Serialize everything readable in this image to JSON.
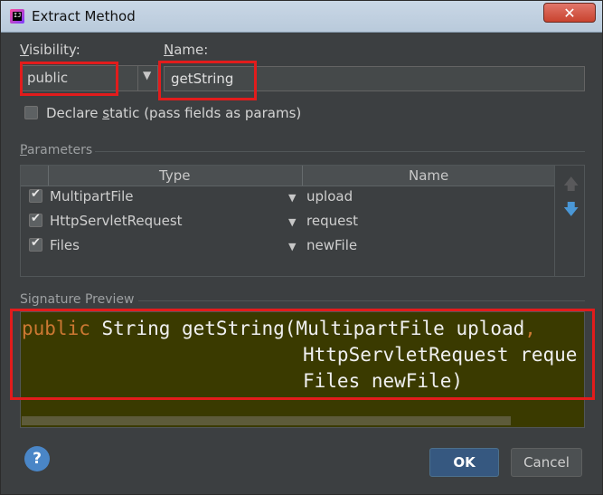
{
  "window": {
    "title": "Extract Method",
    "close_label": "✕"
  },
  "visibility": {
    "label_mnemonic": "V",
    "label_rest": "isibility:",
    "value": "public"
  },
  "name": {
    "label_mnemonic": "N",
    "label_rest": "ame:",
    "value": "getString"
  },
  "declare_static": {
    "checked": false,
    "label_pre": "Declare ",
    "label_mnemonic": "s",
    "label_post": "tatic (pass fields as params)"
  },
  "parameters": {
    "title_mnemonic": "P",
    "title_rest": "arameters",
    "columns": [
      "Type",
      "Name"
    ],
    "rows": [
      {
        "checked": true,
        "type": "MultipartFile",
        "name": "upload"
      },
      {
        "checked": true,
        "type": "HttpServletRequest",
        "name": "request"
      },
      {
        "checked": true,
        "type": "Files",
        "name": "newFile"
      }
    ],
    "move_up_icon": "arrow-up-icon",
    "move_down_icon": "arrow-down-icon"
  },
  "signature_preview": {
    "title": "Signature Preview",
    "line1_keyword": "public",
    "line1_rest": " String getString(MultipartFile upload",
    "line1_comma": ",",
    "line2": "HttpServletRequest reque",
    "line3": "Files newFile)"
  },
  "footer": {
    "help_label": "?",
    "ok_label": "OK",
    "cancel_label": "Cancel"
  },
  "colors": {
    "highlight_box": "#e21c1c",
    "keyword": "#cc7832",
    "preview_bg": "#3a3a00"
  }
}
